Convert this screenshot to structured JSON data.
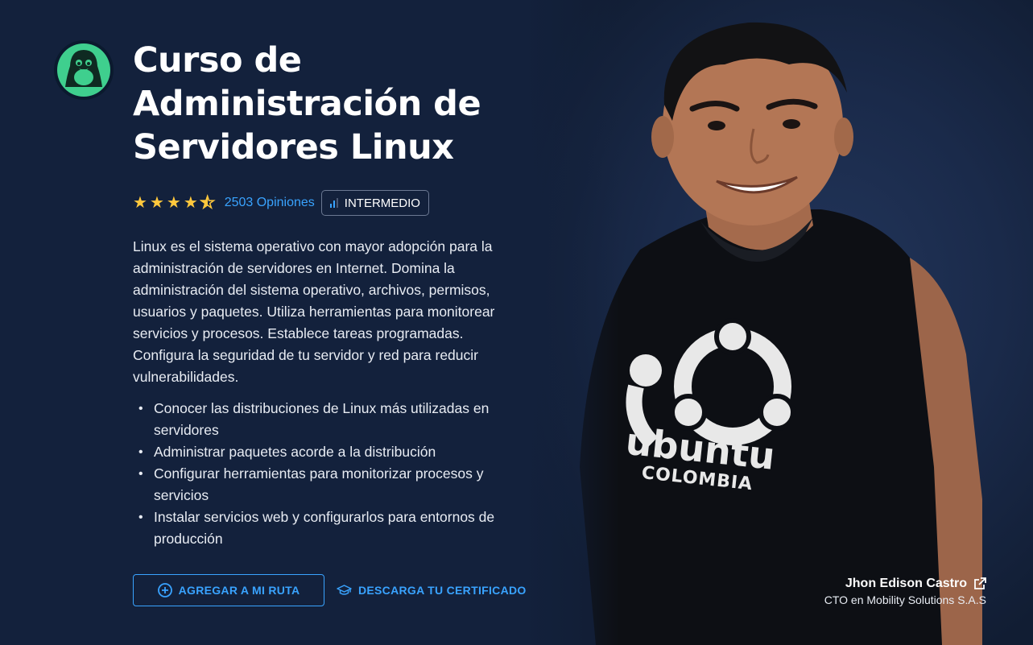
{
  "course": {
    "title": "Curso de Administración de Servidores Linux",
    "logo_icon": "linux-penguin-icon",
    "rating": 4.5,
    "rating_max": 5,
    "opinions": "2503 Opiniones",
    "level": "INTERMEDIO",
    "description": "Linux es el sistema operativo con mayor adopción para la administración de servidores en Internet. Domina la administración del sistema operativo, archivos, permisos, usuarios y paquetes. Utiliza herramientas para monitorear servicios y procesos. Establece tareas programadas. Configura la seguridad de tu servidor y red para reducir vulnerabilidades.",
    "goals": [
      "Conocer las distribuciones de Linux más utilizadas en servidores",
      "Administrar paquetes acorde a la distribución",
      "Configurar herramientas para monitorizar procesos y servicios",
      "Instalar servicios web y configurarlos para entornos de producción"
    ]
  },
  "actions": {
    "route_label": "AGREGAR A MI RUTA",
    "certificate_label": "DESCARGA TU CERTIFICADO"
  },
  "teacher": {
    "name": "Jhon Edison Castro",
    "role": "CTO en Mobility Solutions S.A.S",
    "shirt_logo_line1": "ubuntu",
    "shirt_logo_line2": "COLOMBIA"
  },
  "colors": {
    "background": "#13213c",
    "accent": "#39a3ff",
    "star": "#ffc83d",
    "logo_green": "#3fcf8e"
  }
}
